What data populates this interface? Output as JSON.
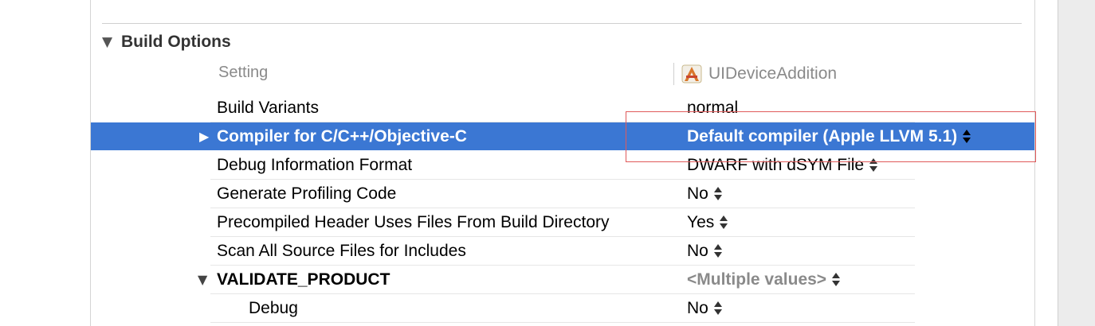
{
  "section": {
    "title": "Build Options"
  },
  "columns": {
    "setting": "Setting",
    "target": "UIDeviceAddition"
  },
  "rows": [
    {
      "label": "Build Variants",
      "value": "normal"
    },
    {
      "label": "Compiler for C/C++/Objective-C",
      "value": "Default compiler (Apple LLVM 5.1)"
    },
    {
      "label": "Debug Information Format",
      "value": "DWARF with dSYM File"
    },
    {
      "label": "Generate Profiling Code",
      "value": "No"
    },
    {
      "label": "Precompiled Header Uses Files From Build Directory",
      "value": "Yes"
    },
    {
      "label": "Scan All Source Files for Includes",
      "value": "No"
    },
    {
      "label": "VALIDATE_PRODUCT",
      "value": "<Multiple values>"
    },
    {
      "label": "Debug",
      "value": "No"
    }
  ],
  "icons": {
    "section_toggle": "disclosure-down-icon",
    "target": "app-target-icon"
  },
  "colors": {
    "selection": "#3b77d3",
    "annotation": "#e05a5a"
  }
}
